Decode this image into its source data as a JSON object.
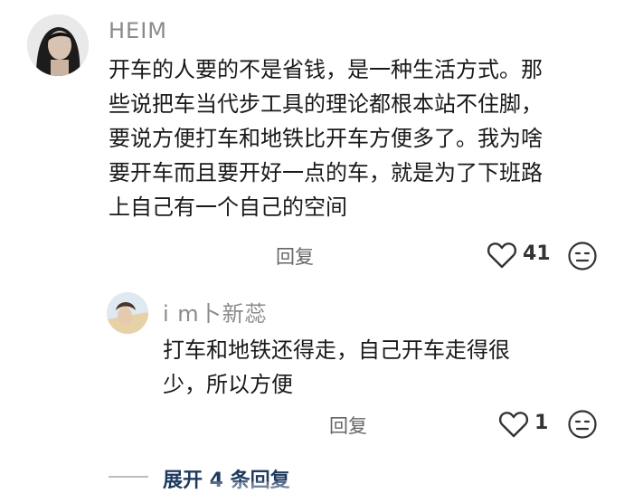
{
  "comment": {
    "username": "HEIM",
    "text": "开车的人要的不是省钱，是一种生活方式。那些说把车当代步工具的理论都根本站不住脚，要说方便打车和地铁比开车方便多了。我为啥要开车而且要开好一点的车，就是为了下班路上自己有一个自己的空间",
    "reply_label": "回复",
    "like_count": "41"
  },
  "reply": {
    "username": "i m卜新蕊",
    "text": "打车和地铁还得走，自己开车走得很少，所以方便",
    "reply_label": "回复",
    "like_count": "1"
  },
  "expand_label": "展开 4 条回复",
  "icons": {
    "like": "heart-outline-icon",
    "dislike": "neutral-face-icon"
  }
}
